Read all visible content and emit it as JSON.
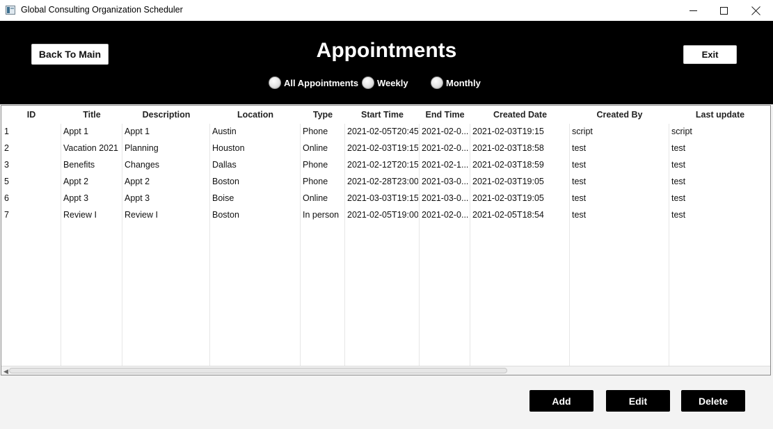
{
  "window": {
    "title": "Global Consulting Organization Scheduler",
    "controls": [
      "minimize",
      "maximize",
      "close"
    ]
  },
  "header": {
    "back_label": "Back To Main",
    "page_title": "Appointments",
    "exit_label": "Exit",
    "filters": [
      {
        "label": "All Appointments",
        "selected": false
      },
      {
        "label": "Weekly",
        "selected": false
      },
      {
        "label": "Monthly",
        "selected": false
      }
    ]
  },
  "table": {
    "columns": [
      "ID",
      "Title",
      "Description",
      "Location",
      "Type",
      "Start Time",
      "End Time",
      "Created Date",
      "Created By",
      "Last update"
    ],
    "rows": [
      [
        "1",
        "Appt 1",
        "Appt 1",
        "Austin",
        "Phone",
        "2021-02-05T20:45",
        "2021-02-0...",
        "2021-02-03T19:15",
        "script",
        "script"
      ],
      [
        "2",
        "Vacation 2021",
        "Planning",
        "Houston",
        "Online",
        "2021-02-03T19:15",
        "2021-02-0...",
        "2021-02-03T18:58",
        "test",
        "test"
      ],
      [
        "3",
        "Benefits",
        "Changes",
        "Dallas",
        "Phone",
        "2021-02-12T20:15",
        "2021-02-1...",
        "2021-02-03T18:59",
        "test",
        "test"
      ],
      [
        "5",
        "Appt 2",
        "Appt 2",
        "Boston",
        "Phone",
        "2021-02-28T23:00",
        "2021-03-0...",
        "2021-02-03T19:05",
        "test",
        "test"
      ],
      [
        "6",
        "Appt 3",
        "Appt 3",
        "Boise",
        "Online",
        "2021-03-03T19:15",
        "2021-03-0...",
        "2021-02-03T19:05",
        "test",
        "test"
      ],
      [
        "7",
        "Review I",
        "Review I",
        "Boston",
        "In person",
        "2021-02-05T19:00",
        "2021-02-0...",
        "2021-02-05T18:54",
        "test",
        "test"
      ]
    ],
    "scroll_left_icon": "chevron-left-icon"
  },
  "actions": {
    "add_label": "Add",
    "edit_label": "Edit",
    "delete_label": "Delete"
  },
  "colors": {
    "header_bg": "#000000",
    "action_button_bg": "#000000",
    "page_bg": "#f3f3f3"
  }
}
